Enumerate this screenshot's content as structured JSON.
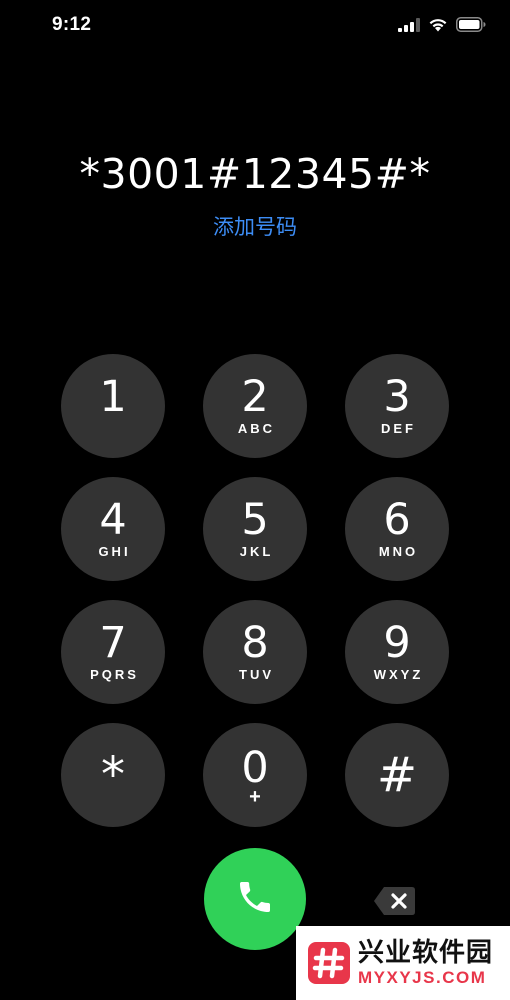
{
  "status_bar": {
    "time": "9:12",
    "signal_icon": "signal-bars-icon",
    "wifi_icon": "wifi-icon",
    "battery_icon": "battery-icon"
  },
  "dialer": {
    "number": "*3001#12345#*",
    "add_number_label": "添加号码",
    "add_number_color": "#3d8df5"
  },
  "keys": [
    {
      "digit": "1",
      "letters": ""
    },
    {
      "digit": "2",
      "letters": "ABC"
    },
    {
      "digit": "3",
      "letters": "DEF"
    },
    {
      "digit": "4",
      "letters": "GHI"
    },
    {
      "digit": "5",
      "letters": "JKL"
    },
    {
      "digit": "6",
      "letters": "MNO"
    },
    {
      "digit": "7",
      "letters": "PQRS"
    },
    {
      "digit": "8",
      "letters": "TUV"
    },
    {
      "digit": "9",
      "letters": "WXYZ"
    },
    {
      "digit": "*",
      "letters": ""
    },
    {
      "digit": "0",
      "letters": "+"
    },
    {
      "digit": "#",
      "letters": ""
    }
  ],
  "call_button": {
    "icon": "phone-icon",
    "color": "#30d158"
  },
  "delete_button": {
    "icon": "backspace-icon"
  },
  "watermark": {
    "title": "兴业软件园",
    "url": "MYXYJS.COM",
    "brand_color": "#e8364a"
  }
}
